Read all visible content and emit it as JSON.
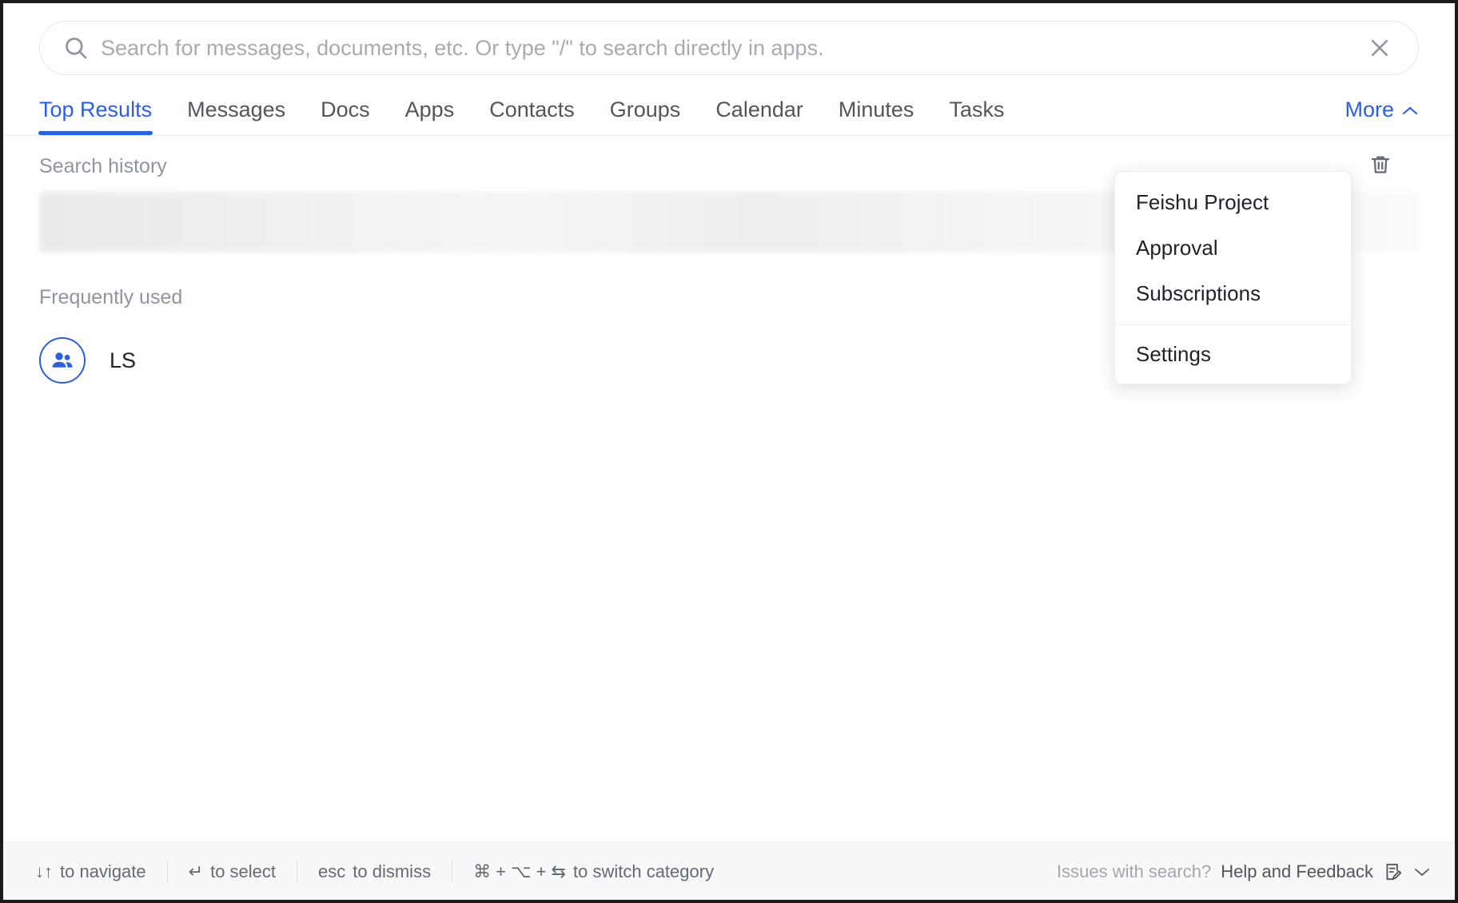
{
  "search": {
    "placeholder": "Search for messages, documents, etc. Or type \"/\" to search directly in apps.",
    "value": "",
    "icons": {
      "search": "search-icon",
      "clear": "close-icon"
    }
  },
  "tabs": {
    "items": [
      {
        "label": "Top Results",
        "active": true
      },
      {
        "label": "Messages",
        "active": false
      },
      {
        "label": "Docs",
        "active": false
      },
      {
        "label": "Apps",
        "active": false
      },
      {
        "label": "Contacts",
        "active": false
      },
      {
        "label": "Groups",
        "active": false
      },
      {
        "label": "Calendar",
        "active": false
      },
      {
        "label": "Minutes",
        "active": false
      },
      {
        "label": "Tasks",
        "active": false
      }
    ],
    "more_label": "More"
  },
  "dropdown": {
    "open": true,
    "items": [
      {
        "label": "Feishu Project"
      },
      {
        "label": "Approval"
      },
      {
        "label": "Subscriptions"
      }
    ],
    "settings_label": "Settings"
  },
  "history": {
    "title": "Search history",
    "clear_icon": "trash-icon"
  },
  "frequent": {
    "title": "Frequently used",
    "items": [
      {
        "label": "LS",
        "avatar_icon": "people-group-icon"
      }
    ]
  },
  "footer": {
    "hints": [
      {
        "keys": "↓↑",
        "text": "to navigate"
      },
      {
        "keys": "↵",
        "text": "to select"
      },
      {
        "keys": "esc",
        "text": "to dismiss"
      },
      {
        "keys": "⌘ + ⌥ + ⇆",
        "text": "to switch category"
      }
    ],
    "issues_text": "Issues with search?",
    "help_label": "Help and Feedback",
    "feedback_icon": "document-edit-icon",
    "chevron_icon": "chevron-down-icon"
  },
  "colors": {
    "accent": "#2b5fe3",
    "text_primary": "#1f2329",
    "text_secondary": "#646a73",
    "text_muted": "#8f959e",
    "footer_bg": "#f7f8fa",
    "border": "#e8eaee"
  }
}
